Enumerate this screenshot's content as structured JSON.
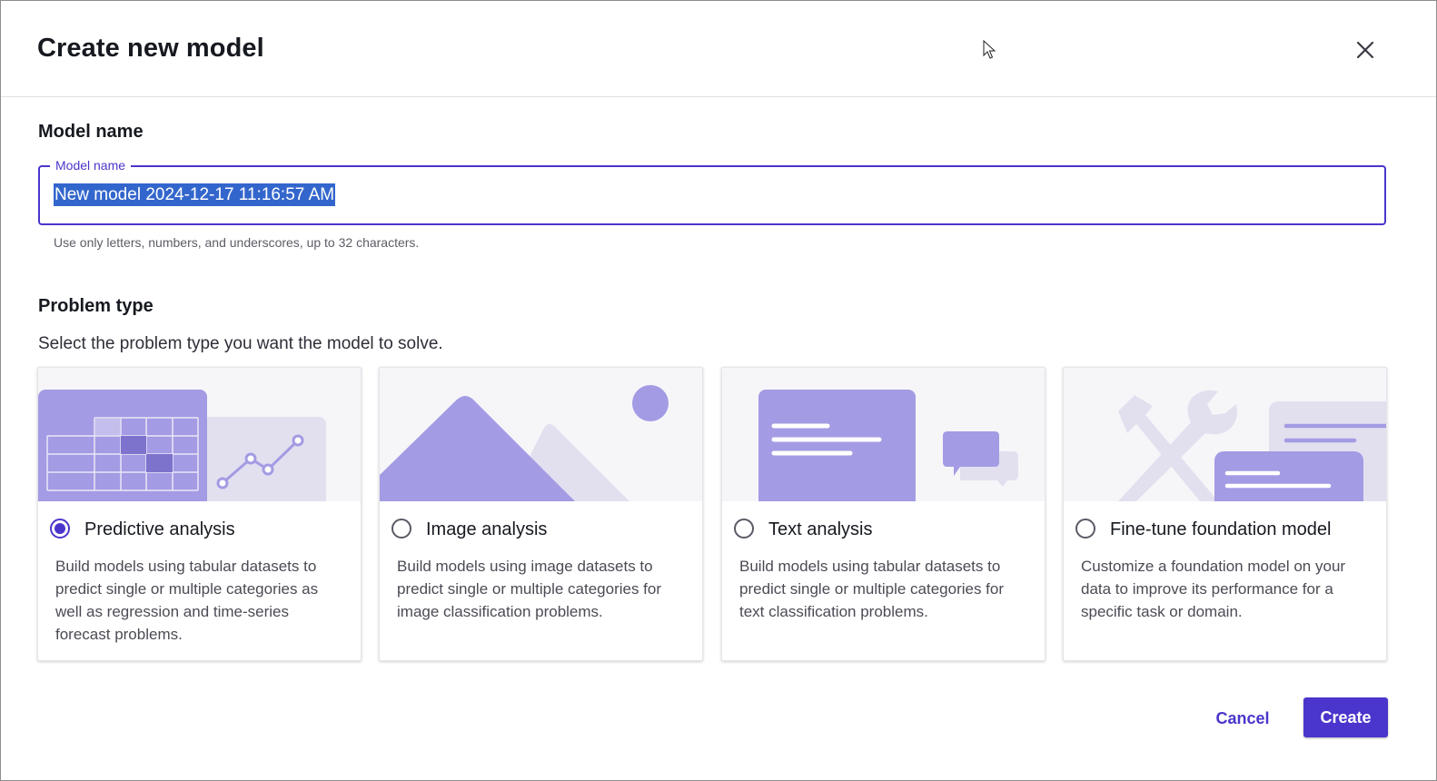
{
  "dialog": {
    "title": "Create new model",
    "close_icon": "close-icon"
  },
  "model_name_section": {
    "heading": "Model name",
    "field_label": "Model name",
    "value": "New model 2024-12-17 11:16:57 AM",
    "helper": "Use only letters, numbers, and underscores, up to 32 characters."
  },
  "problem_type": {
    "heading": "Problem type",
    "description": "Select the problem type you want the model to solve.",
    "options": [
      {
        "label": "Predictive analysis",
        "description": "Build models using tabular datasets to predict single or multiple categories as well as regression and time-series forecast problems.",
        "selected": true,
        "illustration": "table-chart-illustration"
      },
      {
        "label": "Image analysis",
        "description": "Build models using image datasets to predict single or multiple categories for image classification problems.",
        "selected": false,
        "illustration": "mountain-image-illustration"
      },
      {
        "label": "Text analysis",
        "description": "Build models using tabular datasets to predict single or multiple categories for text classification problems.",
        "selected": false,
        "illustration": "text-chat-illustration"
      },
      {
        "label": "Fine-tune foundation model",
        "description": "Customize a foundation model on your data to improve its performance for a specific task or domain.",
        "selected": false,
        "illustration": "tools-illustration"
      }
    ]
  },
  "footer": {
    "cancel_label": "Cancel",
    "create_label": "Create"
  },
  "colors": {
    "accent": "#4a36cc",
    "illustration_purple": "#a39be3",
    "illustration_light": "#e2e0ef",
    "selection": "#3366cc"
  }
}
